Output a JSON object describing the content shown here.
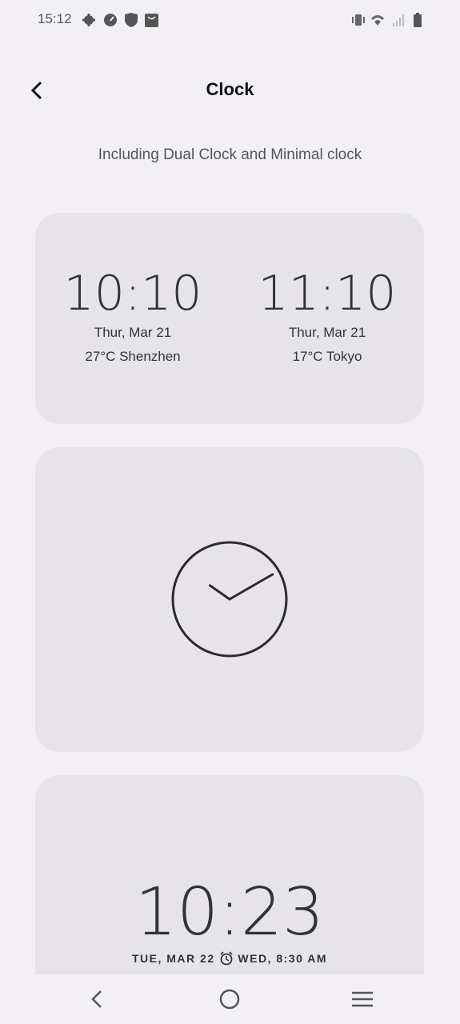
{
  "status_bar": {
    "time": "15:12",
    "left_icons": [
      "gear-icon",
      "speedometer-icon",
      "shield-check-icon",
      "shopping-bag-icon"
    ],
    "right_icons": [
      "vibrate-icon",
      "wifi-icon",
      "signal-icon",
      "battery-icon"
    ]
  },
  "header": {
    "title": "Clock",
    "back_icon": "chevron-left-icon"
  },
  "subtitle": "Including Dual Clock and Minimal clock",
  "dual_clock": {
    "left": {
      "time": "10:10",
      "date": "Thur,  Mar 21",
      "weather": "27°C  Shenzhen"
    },
    "right": {
      "time": "11:10",
      "date": "Thur,  Mar 21",
      "weather": "17°C  Tokyo"
    }
  },
  "analog_clock": {
    "hours": 10,
    "minutes": 10
  },
  "minimal_clock": {
    "time": "10:23",
    "date": "TUE, MAR 22",
    "alarm": "WED, 8:30 AM",
    "alarm_icon": "alarm-clock-icon"
  },
  "nav_bar": {
    "icons": [
      "back-icon",
      "home-icon",
      "recents-icon"
    ]
  },
  "colors": {
    "background": "#f2f0f5",
    "card": "#e6e4e9",
    "text": "#333333"
  }
}
